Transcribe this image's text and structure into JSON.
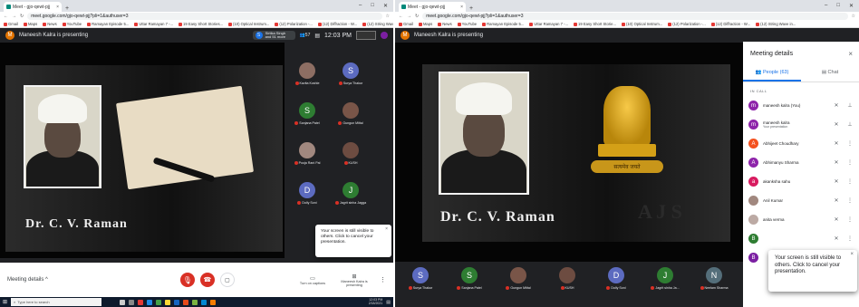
{
  "left": {
    "tab_title": "Meet - gjo-qewt-pjj",
    "url": "meet.google.com/gjo-qewt-pjj?pli=1&authuser=3",
    "bookmarks": [
      "Gmail",
      "Maps",
      "News",
      "YouTube",
      "Ramayan Episode 5...",
      "Uttar Ramayan 7 -...",
      "19 Easy Short Stories...",
      "(10) Optical Instrum...",
      "(12) Polarization -...",
      "(12) Diffraction - W...",
      "(12) String Wave in..."
    ],
    "presenting_text": "Maneesh Kalra is presenting",
    "presenter_initial": "M",
    "joined_text": "Sirtika Singh and 51 more",
    "joined_initial": "S",
    "participant_count": "57",
    "clock": "12:03 PM",
    "portrait_caption": "Dr. C. V. Raman",
    "tiles": [
      {
        "name": "Kavita Koshle",
        "initial": "",
        "color": "#8d6e63"
      },
      {
        "name": "Surya Thakur",
        "initial": "S",
        "color": "#5c6bc0"
      },
      {
        "name": "Sanjana Patel",
        "initial": "S",
        "color": "#2e7d32"
      },
      {
        "name": "Gungun Mittal",
        "initial": "",
        "color": "#795548"
      },
      {
        "name": "Pooja Rani Pal",
        "initial": "",
        "color": "#a1887f"
      },
      {
        "name": "KUSH",
        "initial": "",
        "color": "#6d4c41"
      },
      {
        "name": "Dolly Soni",
        "initial": "D",
        "color": "#5c6bc0"
      },
      {
        "name": "Jagrit sinha Jagga",
        "initial": "J",
        "color": "#2e7d32"
      }
    ],
    "toast_text": "Your screen is still visible to others. Click to cancel your presentation.",
    "meeting_details": "Meeting details",
    "captions": "Turn on captions",
    "present_label": "Maneesh Kalra is presenting",
    "taskbar_search": "Type here to search",
    "taskbar_time": "12:03 PM",
    "taskbar_date": "2/18/2021"
  },
  "right": {
    "tab_title": "Meet - gjo-qewt-pjj",
    "url": "meet.google.com/gjo-qewt-pjj?pli=1&authuser=3",
    "bookmarks": [
      "Gmail",
      "Maps",
      "News",
      "YouTube",
      "Ramayan Episode 5...",
      "Uttar Ramayan 7 -...",
      "19 Easy Short Storie...",
      "(10) Optical Instrum...",
      "(12) Polarization -...",
      "(12) Diffraction - W...",
      "(12) String Wave in..."
    ],
    "presenting_text": "Maneesh Kalra is presenting",
    "presenter_initial": "M",
    "portrait_caption": "Dr. C. V. Raman",
    "emblem_motto": "सत्यमेव जयते",
    "watermark": "A J S",
    "strip": [
      {
        "name": "Surya Thakur",
        "initial": "S",
        "color": "#5c6bc0"
      },
      {
        "name": "Sanjana Patel",
        "initial": "S",
        "color": "#2e7d32"
      },
      {
        "name": "Gungun Mittal",
        "initial": "",
        "color": "#795548"
      },
      {
        "name": "KUSH",
        "initial": "",
        "color": "#6d4c41"
      },
      {
        "name": "Dolly Soni",
        "initial": "D",
        "color": "#5c6bc0"
      },
      {
        "name": "Jagrit sinha Ja...",
        "initial": "J",
        "color": "#2e7d32"
      },
      {
        "name": "Neelam Sharma",
        "initial": "N",
        "color": "#546e7a"
      }
    ],
    "panel": {
      "title": "Meeting details",
      "people_tab": "People (63)",
      "chat_tab": "Chat",
      "in_call": "IN CALL",
      "people": [
        {
          "name": "maneesh kalra (You)",
          "sub": "",
          "initial": "m",
          "color": "#8e24aa"
        },
        {
          "name": "maneesh kalra",
          "sub": "Your presentation",
          "initial": "m",
          "color": "#8e24aa"
        },
        {
          "name": "Abhijeet Choudhary",
          "sub": "",
          "initial": "A",
          "color": "#f4511e"
        },
        {
          "name": "Abhimanyu Sharma",
          "sub": "",
          "initial": "A",
          "color": "#8e24aa"
        },
        {
          "name": "akanksha sahu",
          "sub": "",
          "initial": "a",
          "color": "#d81b60"
        },
        {
          "name": "Anil Kumar",
          "sub": "",
          "initial": "",
          "color": "#a1887f"
        },
        {
          "name": "anita verma",
          "sub": "",
          "initial": "",
          "color": "#bcaaa4"
        },
        {
          "name": "",
          "sub": "",
          "initial": "B",
          "color": "#2e7d32"
        },
        {
          "name": "",
          "sub": "",
          "initial": "B",
          "color": "#7b1fa2"
        }
      ]
    },
    "toast_text": "Your screen is still visible to others. Click to cancel your presentation."
  }
}
